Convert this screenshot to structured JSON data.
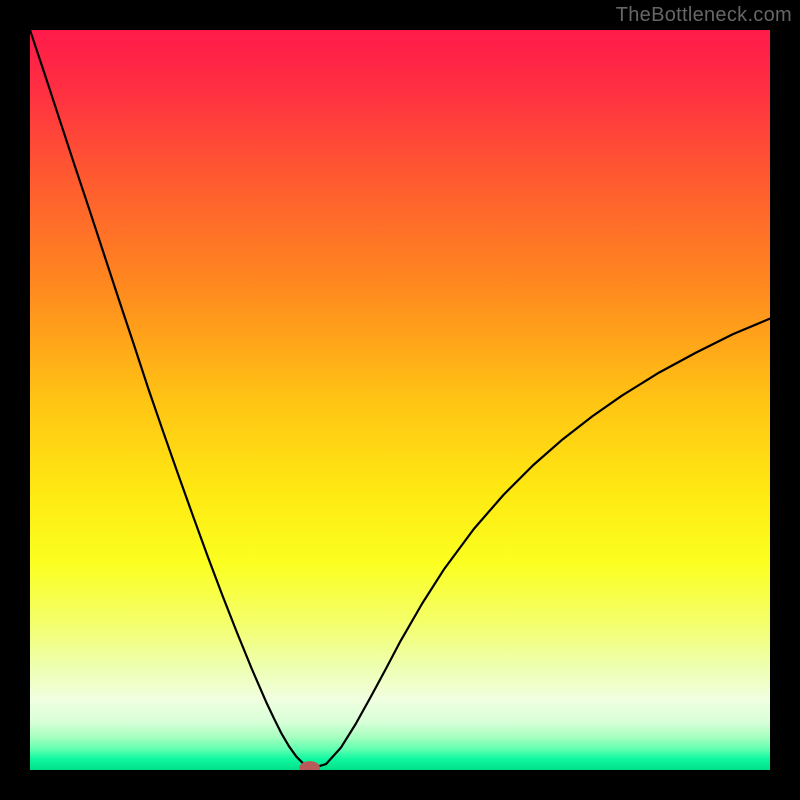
{
  "watermark": "TheBottleneck.com",
  "chart_data": {
    "type": "line",
    "title": "",
    "xlabel": "",
    "ylabel": "",
    "xlim": [
      0,
      100
    ],
    "ylim": [
      0,
      100
    ],
    "background_gradient": {
      "stops": [
        {
          "offset": 0.0,
          "color": "#ff1a4a"
        },
        {
          "offset": 0.08,
          "color": "#ff2f42"
        },
        {
          "offset": 0.2,
          "color": "#ff5a30"
        },
        {
          "offset": 0.35,
          "color": "#ff8a1e"
        },
        {
          "offset": 0.5,
          "color": "#ffc414"
        },
        {
          "offset": 0.62,
          "color": "#ffe812"
        },
        {
          "offset": 0.72,
          "color": "#fbff20"
        },
        {
          "offset": 0.8,
          "color": "#f4ff6a"
        },
        {
          "offset": 0.86,
          "color": "#eeffb0"
        },
        {
          "offset": 0.905,
          "color": "#f0ffe0"
        },
        {
          "offset": 0.935,
          "color": "#d8ffd8"
        },
        {
          "offset": 0.955,
          "color": "#a8ffc0"
        },
        {
          "offset": 0.972,
          "color": "#60ffb0"
        },
        {
          "offset": 0.985,
          "color": "#10f8a0"
        },
        {
          "offset": 1.0,
          "color": "#00e088"
        }
      ]
    },
    "series": [
      {
        "name": "bottleneck-curve",
        "color": "#000000",
        "width": 2.2,
        "x": [
          0,
          2,
          4,
          6,
          8,
          10,
          12,
          14,
          16,
          18,
          20,
          22,
          24,
          26,
          28,
          30,
          32,
          33,
          34,
          35,
          36,
          37,
          38,
          40,
          42,
          44,
          46,
          48,
          50,
          53,
          56,
          60,
          64,
          68,
          72,
          76,
          80,
          85,
          90,
          95,
          100
        ],
        "y": [
          100,
          94.0,
          87.9,
          81.8,
          75.8,
          69.7,
          63.6,
          57.6,
          51.5,
          45.7,
          40.0,
          34.4,
          28.9,
          23.6,
          18.5,
          13.6,
          9.0,
          6.9,
          4.9,
          3.2,
          1.8,
          0.8,
          0.2,
          0.8,
          3.0,
          6.2,
          9.8,
          13.5,
          17.3,
          22.5,
          27.2,
          32.6,
          37.2,
          41.2,
          44.7,
          47.8,
          50.6,
          53.7,
          56.4,
          58.9,
          61.0
        ]
      }
    ],
    "marker": {
      "name": "optimal-point",
      "x": 37.8,
      "y": 0.3,
      "rx": 1.4,
      "ry": 0.9,
      "color": "#b85a5a"
    }
  }
}
